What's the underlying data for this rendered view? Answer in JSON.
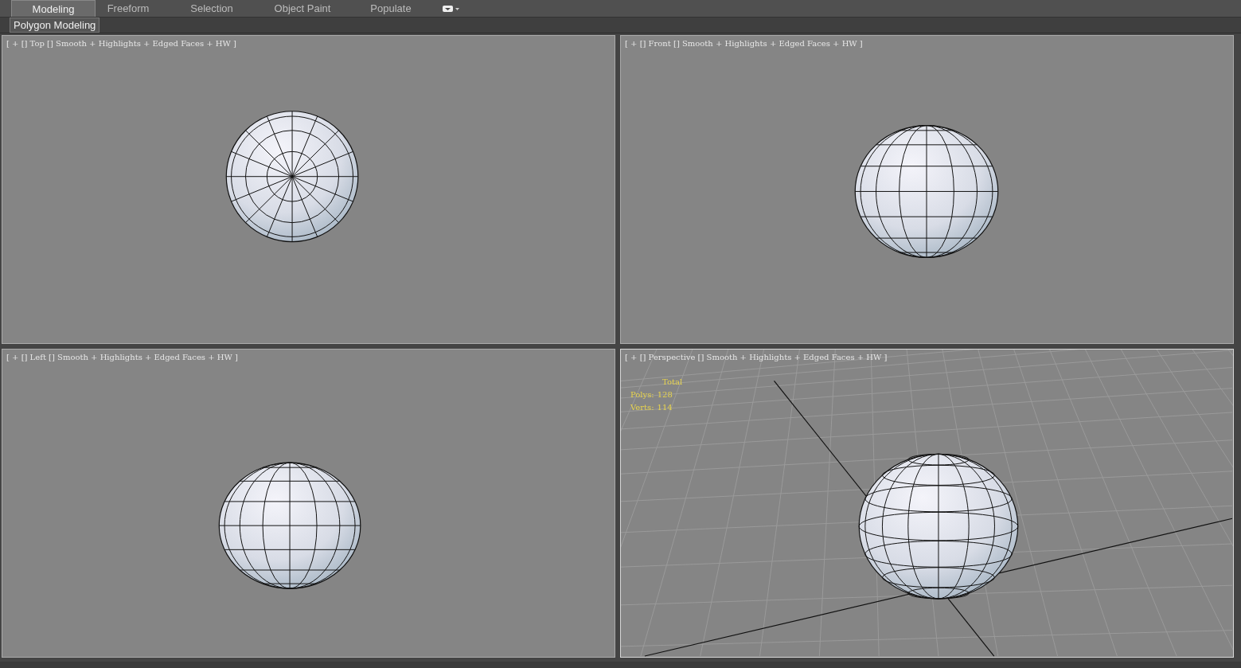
{
  "ribbon": {
    "tabs": [
      {
        "label": "Modeling",
        "selected": true
      },
      {
        "label": "Freeform",
        "selected": false
      },
      {
        "label": "Selection",
        "selected": false
      },
      {
        "label": "Object Paint",
        "selected": false
      },
      {
        "label": "Populate",
        "selected": false
      }
    ],
    "panel_label": "Polygon Modeling"
  },
  "viewports": [
    {
      "kind": "top",
      "label": "[ + [] Top [] Smooth + Highlights + Edged Faces + HW ]"
    },
    {
      "kind": "side",
      "label": "[ + [] Front [] Smooth + Highlights + Edged Faces + HW ]"
    },
    {
      "kind": "side",
      "label": "[ + [] Left [] Smooth + Highlights + Edged Faces + HW ]"
    },
    {
      "kind": "perspective",
      "label": "[ + [] Perspective [] Smooth + Highlights + Edged Faces + HW ]",
      "stats": {
        "heading": "Total",
        "rows": [
          {
            "label": "Polys:",
            "value": "128"
          },
          {
            "label": "Verts:",
            "value": "114"
          }
        ]
      }
    }
  ]
}
